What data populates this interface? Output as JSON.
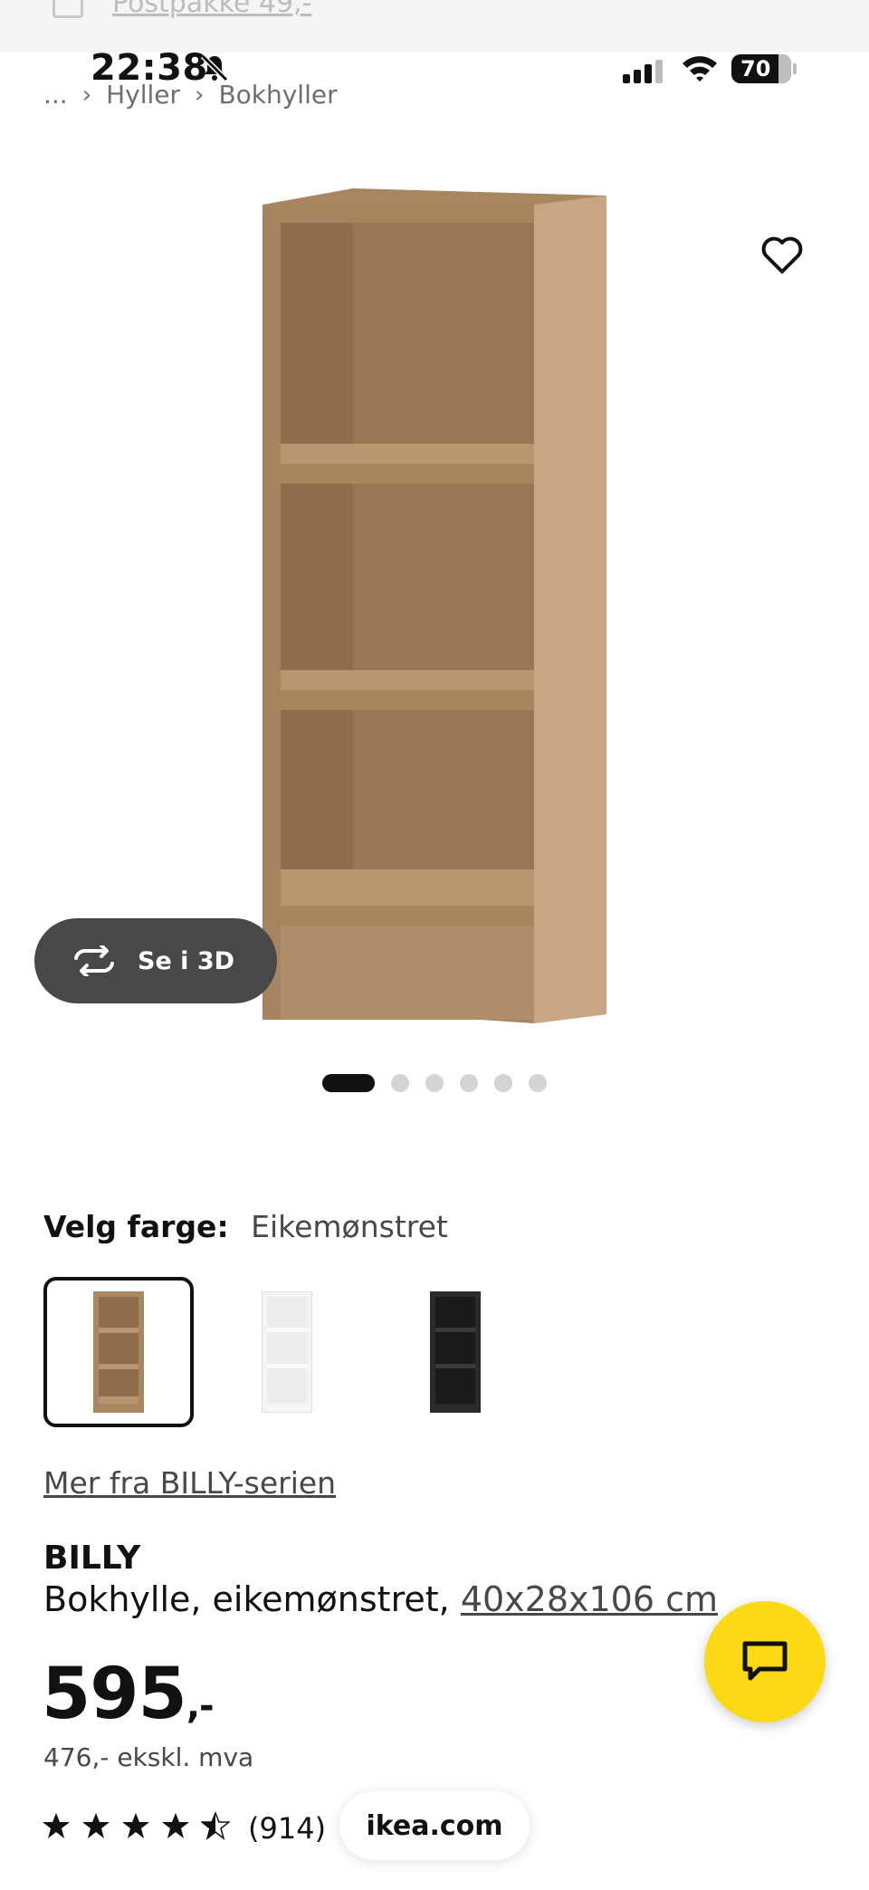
{
  "top_strip": {
    "text": "Postpakke 49,-"
  },
  "status_bar": {
    "time": "22:38",
    "battery": "70"
  },
  "breadcrumb": {
    "ellipsis": "...",
    "items": [
      "Hyller",
      "Bokhyller"
    ]
  },
  "gallery": {
    "view_3d_label": "Se i 3D",
    "image_count": 6,
    "active_index": 0
  },
  "color": {
    "label": "Velg farge:",
    "selected": "Eikemønstret",
    "swatches": [
      {
        "name": "oak",
        "color": "#a98763",
        "selected": true
      },
      {
        "name": "white",
        "color": "#f4f4f4",
        "selected": false
      },
      {
        "name": "black",
        "color": "#2a2a2a",
        "selected": false
      }
    ]
  },
  "series_link": "Mer fra BILLY-serien",
  "product": {
    "name": "BILLY",
    "description": "Bokhylle, eikemønstret,",
    "dimensions": "40x28x106 cm",
    "price": "595",
    "price_suffix": ",-",
    "price_ex_vat": "476,- ekskl. mva",
    "rating_stars": 4.5,
    "review_count": "(914)"
  },
  "url_bar": {
    "domain": "ikea.com"
  },
  "colors": {
    "chat_yellow": "#fbd914",
    "dark_button": "#484848"
  }
}
